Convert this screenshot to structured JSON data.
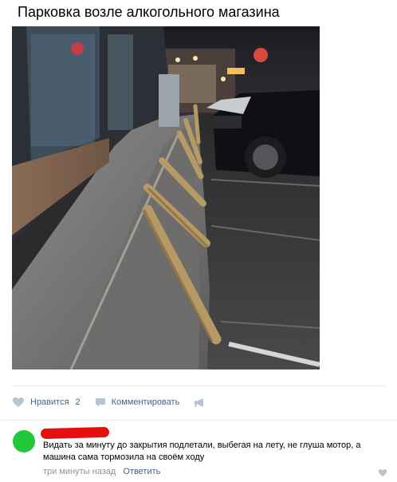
{
  "post": {
    "title": "Парковка возле алкогольного магазина"
  },
  "actions": {
    "like_label": "Нравится",
    "like_count": "2",
    "comment_label": "Комментировать"
  },
  "comment": {
    "text": "Видать за минуту до закрытия подлетали, выбегая на лету, не глуша мотор, а машина сама тормозила на своём ходу",
    "time": "три минуты назад",
    "reply_label": "Ответить"
  },
  "colors": {
    "link": "#42648b",
    "avatar": "#22c837",
    "redaction": "#e50f12"
  }
}
